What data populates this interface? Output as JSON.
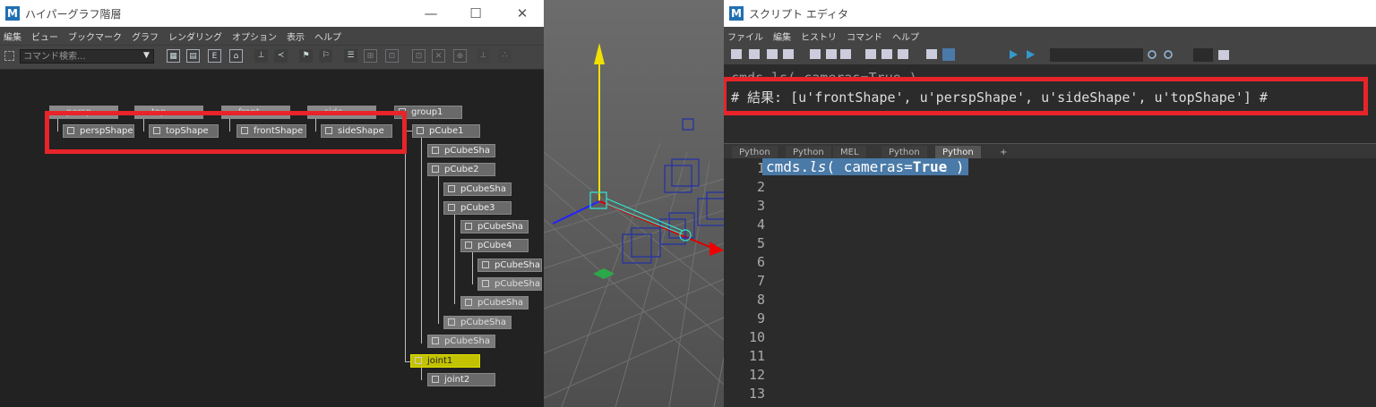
{
  "hypergraph": {
    "title": "ハイパーグラフ階層",
    "menus": [
      "編集",
      "ビュー",
      "ブックマーク",
      "グラフ",
      "レンダリング",
      "オプション",
      "表示",
      "ヘルプ"
    ],
    "search_placeholder": "コマンド検索...",
    "top_cameras": [
      "persp",
      "top",
      "front",
      "side"
    ],
    "shapes": [
      "perspShape",
      "topShape",
      "frontShape",
      "sideShape"
    ],
    "nodes": {
      "group1": "group1",
      "pCube1": "pCube1",
      "pCubeSha1": "pCubeSha",
      "pCube2": "pCube2",
      "pCubeSha2": "pCubeSha",
      "pCube3": "pCube3",
      "pCubeSha3": "pCubeSha",
      "pCube4": "pCube4",
      "pCubeSha4": "pCubeSha",
      "pCubeSha5": "pCubeSha",
      "pCubeSha6": "pCubeSha",
      "pCubeSha7": "pCubeSha",
      "pCubeSha8": "pCubeSha",
      "joint1": "joint1",
      "joint2": "joint2"
    }
  },
  "script_editor": {
    "title": "スクリプト エディタ",
    "menus": [
      "ファイル",
      "編集",
      "ヒストリ",
      "コマンド",
      "ヘルプ"
    ],
    "output_prev": "cmds.ls( cameras=True )",
    "output_result": "# 結果: [u'frontShape', u'perspShape', u'sideShape', u'topShape'] #",
    "tabs": [
      "Python",
      "Python",
      "MEL",
      "Python",
      "Python",
      "+"
    ],
    "active_tab_index": 4,
    "line_numbers": [
      "1",
      "2",
      "3",
      "4",
      "5",
      "6",
      "7",
      "8",
      "9",
      "10",
      "11",
      "12",
      "13"
    ],
    "code_line1_prefix": "cmds.",
    "code_line1_func": "ls",
    "code_line1_mid": "( cameras=",
    "code_line1_kw": "True",
    "code_line1_suffix": " )"
  },
  "colors": {
    "highlight": "#e8242a",
    "selection": "#4a7aa8",
    "joint": "#c2c200"
  },
  "window_controls": {
    "minimize": "—",
    "maximize": "☐",
    "close": "✕"
  }
}
